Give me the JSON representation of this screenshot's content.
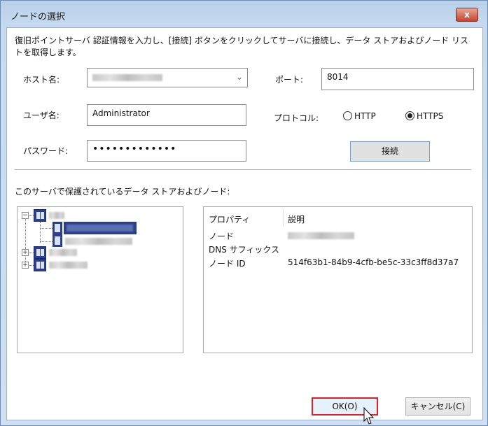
{
  "window": {
    "title": "ノードの選択",
    "close_label": "x"
  },
  "instruction": "復旧ポイントサーバ 認証情報を入力し、[接続] ボタンをクリックしてサーバに接続し、データ ストアおよびノード リストを取得します。",
  "form": {
    "host_label": "ホスト名:",
    "port_label": "ポート:",
    "port_value": "8014",
    "user_label": "ユーザ名:",
    "user_value": "Administrator",
    "protocol_label": "プロトコル:",
    "protocol_options": [
      "HTTP",
      "HTTPS"
    ],
    "protocol_selected": "HTTPS",
    "password_label": "パスワード:",
    "password_value": "•••••••••••••",
    "connect_label": "接続"
  },
  "tree_label": "このサーバで保護されているデータ ストアおよびノード:",
  "properties": {
    "headers": [
      "プロパティ",
      "説明"
    ],
    "rows": [
      {
        "name": "ノード",
        "value": ""
      },
      {
        "name": "DNS サフィックス",
        "value": ""
      },
      {
        "name": "ノード ID",
        "value": "514f63b1-84b9-4cfb-be5c-33c3ff8d37a7"
      }
    ]
  },
  "buttons": {
    "ok": "OK(O)",
    "cancel": "キャンセル(C)"
  }
}
